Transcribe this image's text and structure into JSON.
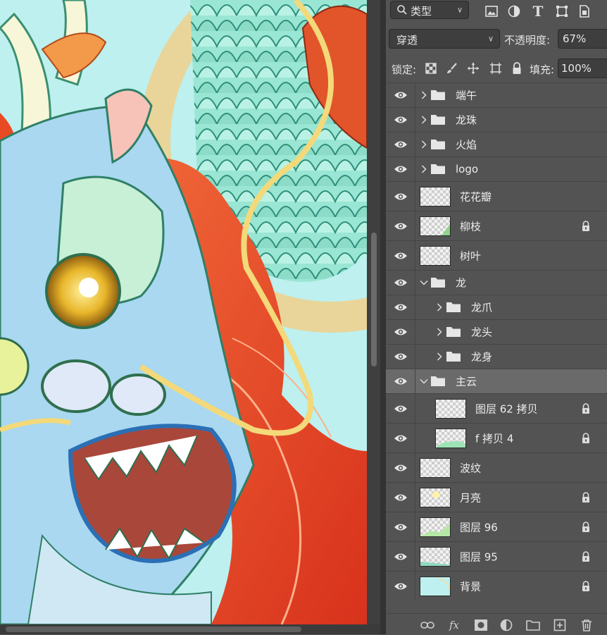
{
  "filter": {
    "kind_label": "类型",
    "search_icon": "search-icon"
  },
  "filter_icons": [
    "image-filter-icon",
    "adjustment-filter-icon",
    "type-filter-icon",
    "shape-filter-icon",
    "smart-object-filter-icon"
  ],
  "blend": {
    "mode": "穿透",
    "opacity_label": "不透明度:",
    "opacity_value": "67%"
  },
  "lock": {
    "label": "锁定:",
    "fill_label": "填充:",
    "fill_value": "100%"
  },
  "layers": [
    {
      "name": "端午",
      "type": "group",
      "expanded": false,
      "indent": 0,
      "locked": false
    },
    {
      "name": "龙珠",
      "type": "group",
      "expanded": false,
      "indent": 0,
      "locked": false
    },
    {
      "name": "火焰",
      "type": "group",
      "expanded": false,
      "indent": 0,
      "locked": false
    },
    {
      "name": "logo",
      "type": "group",
      "expanded": false,
      "indent": 0,
      "locked": false
    },
    {
      "name": "花花瓣",
      "type": "layer",
      "indent": 0,
      "locked": false
    },
    {
      "name": "柳枝",
      "type": "layer",
      "indent": 0,
      "locked": true
    },
    {
      "name": "树叶",
      "type": "layer",
      "indent": 0,
      "locked": false
    },
    {
      "name": "龙",
      "type": "group",
      "expanded": true,
      "indent": 0,
      "locked": false
    },
    {
      "name": "龙爪",
      "type": "group",
      "expanded": false,
      "indent": 1,
      "locked": false
    },
    {
      "name": "龙头",
      "type": "group",
      "expanded": false,
      "indent": 1,
      "locked": false
    },
    {
      "name": "龙身",
      "type": "group",
      "expanded": false,
      "indent": 1,
      "locked": false
    },
    {
      "name": "主云",
      "type": "group",
      "expanded": true,
      "indent": 0,
      "locked": false,
      "selected": true
    },
    {
      "name": "图层 62 拷贝",
      "type": "layer",
      "indent": 1,
      "locked": true
    },
    {
      "name": "f 拷贝 4",
      "type": "layer",
      "indent": 1,
      "locked": true
    },
    {
      "name": "波纹",
      "type": "layer",
      "indent": 0,
      "locked": false
    },
    {
      "name": "月亮",
      "type": "layer",
      "indent": 0,
      "locked": true
    },
    {
      "name": "图层 96",
      "type": "layer",
      "indent": 0,
      "locked": true
    },
    {
      "name": "图层 95",
      "type": "layer",
      "indent": 0,
      "locked": true
    },
    {
      "name": "背景",
      "type": "layer",
      "indent": 0,
      "locked": true
    }
  ],
  "bottom_bar": [
    "link-icon",
    "fx-icon",
    "mask-icon",
    "adjustment-icon",
    "new-group-icon",
    "new-layer-icon",
    "delete-icon"
  ],
  "bottom_bar_fx_label": "fx",
  "colors": {
    "panel_bg": "#535353",
    "selected_row": "#6a6a6a",
    "canvas_bg": "#bdf0ee",
    "dragon_red": "#e0472a",
    "dragon_scales": "#8fe3cf"
  }
}
